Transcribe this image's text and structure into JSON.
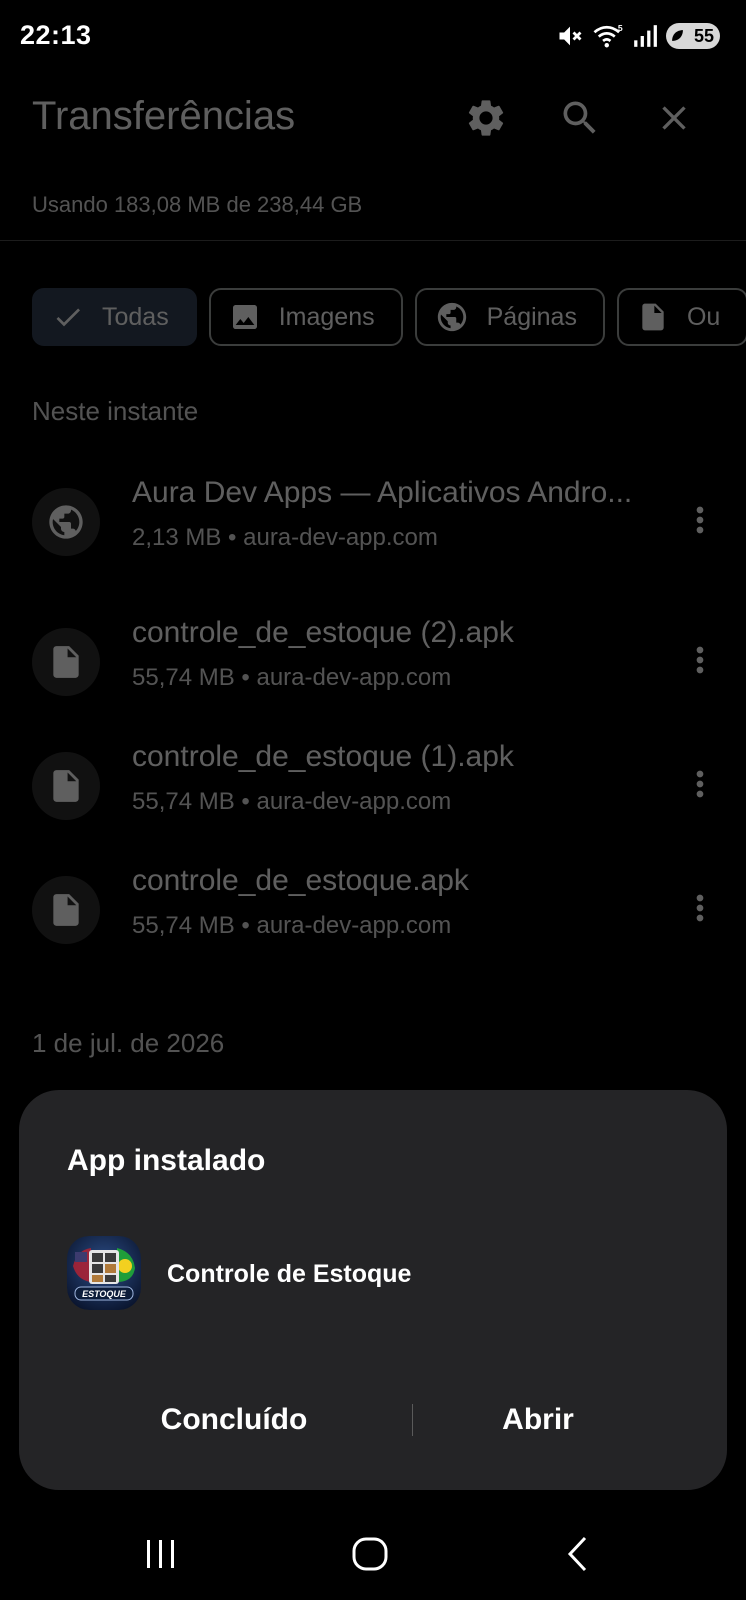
{
  "status_bar": {
    "time": "22:13",
    "battery": "55",
    "icons": [
      "mute-icon",
      "wifi-icon",
      "signal-icon",
      "battery-saver-icon"
    ]
  },
  "app_bar": {
    "title": "Transferências",
    "actions": [
      "settings-icon",
      "search-icon",
      "close-icon"
    ]
  },
  "storage": {
    "usage_text": "Usando 183,08 MB de 238,44 GB"
  },
  "filters": [
    {
      "label": "Todas",
      "icon": "check-icon",
      "selected": true
    },
    {
      "label": "Imagens",
      "icon": "image-icon",
      "selected": false
    },
    {
      "label": "Páginas",
      "icon": "globe-icon",
      "selected": false
    },
    {
      "label": "Ou",
      "icon": "file-icon",
      "selected": false
    }
  ],
  "sections": [
    {
      "header": "Neste instante",
      "items": [
        {
          "name": "Aura Dev Apps — Aplicativos Andro...",
          "meta": "2,13 MB • aura-dev-app.com",
          "icon": "globe-icon"
        },
        {
          "name": "controle_de_estoque (2).apk",
          "meta": "55,74 MB • aura-dev-app.com",
          "icon": "file-icon"
        },
        {
          "name": "controle_de_estoque (1).apk",
          "meta": "55,74 MB • aura-dev-app.com",
          "icon": "file-icon"
        },
        {
          "name": "controle_de_estoque.apk",
          "meta": "55,74 MB • aura-dev-app.com",
          "icon": "file-icon"
        }
      ]
    },
    {
      "header": "1 de jul. de 2026",
      "items": []
    }
  ],
  "dialog": {
    "title": "App instalado",
    "app_name": "Controle de Estoque",
    "icon_text": "ESTOQUE",
    "done_label": "Concluído",
    "open_label": "Abrir"
  },
  "nav_bar": {
    "buttons": [
      "recent-apps-icon",
      "home-icon",
      "back-icon"
    ]
  },
  "colors": {
    "background": "#000000",
    "dialog_bg": "#242426",
    "chip_selected_bg": "#2f3b4e",
    "text_primary": "#e3e3e3"
  }
}
